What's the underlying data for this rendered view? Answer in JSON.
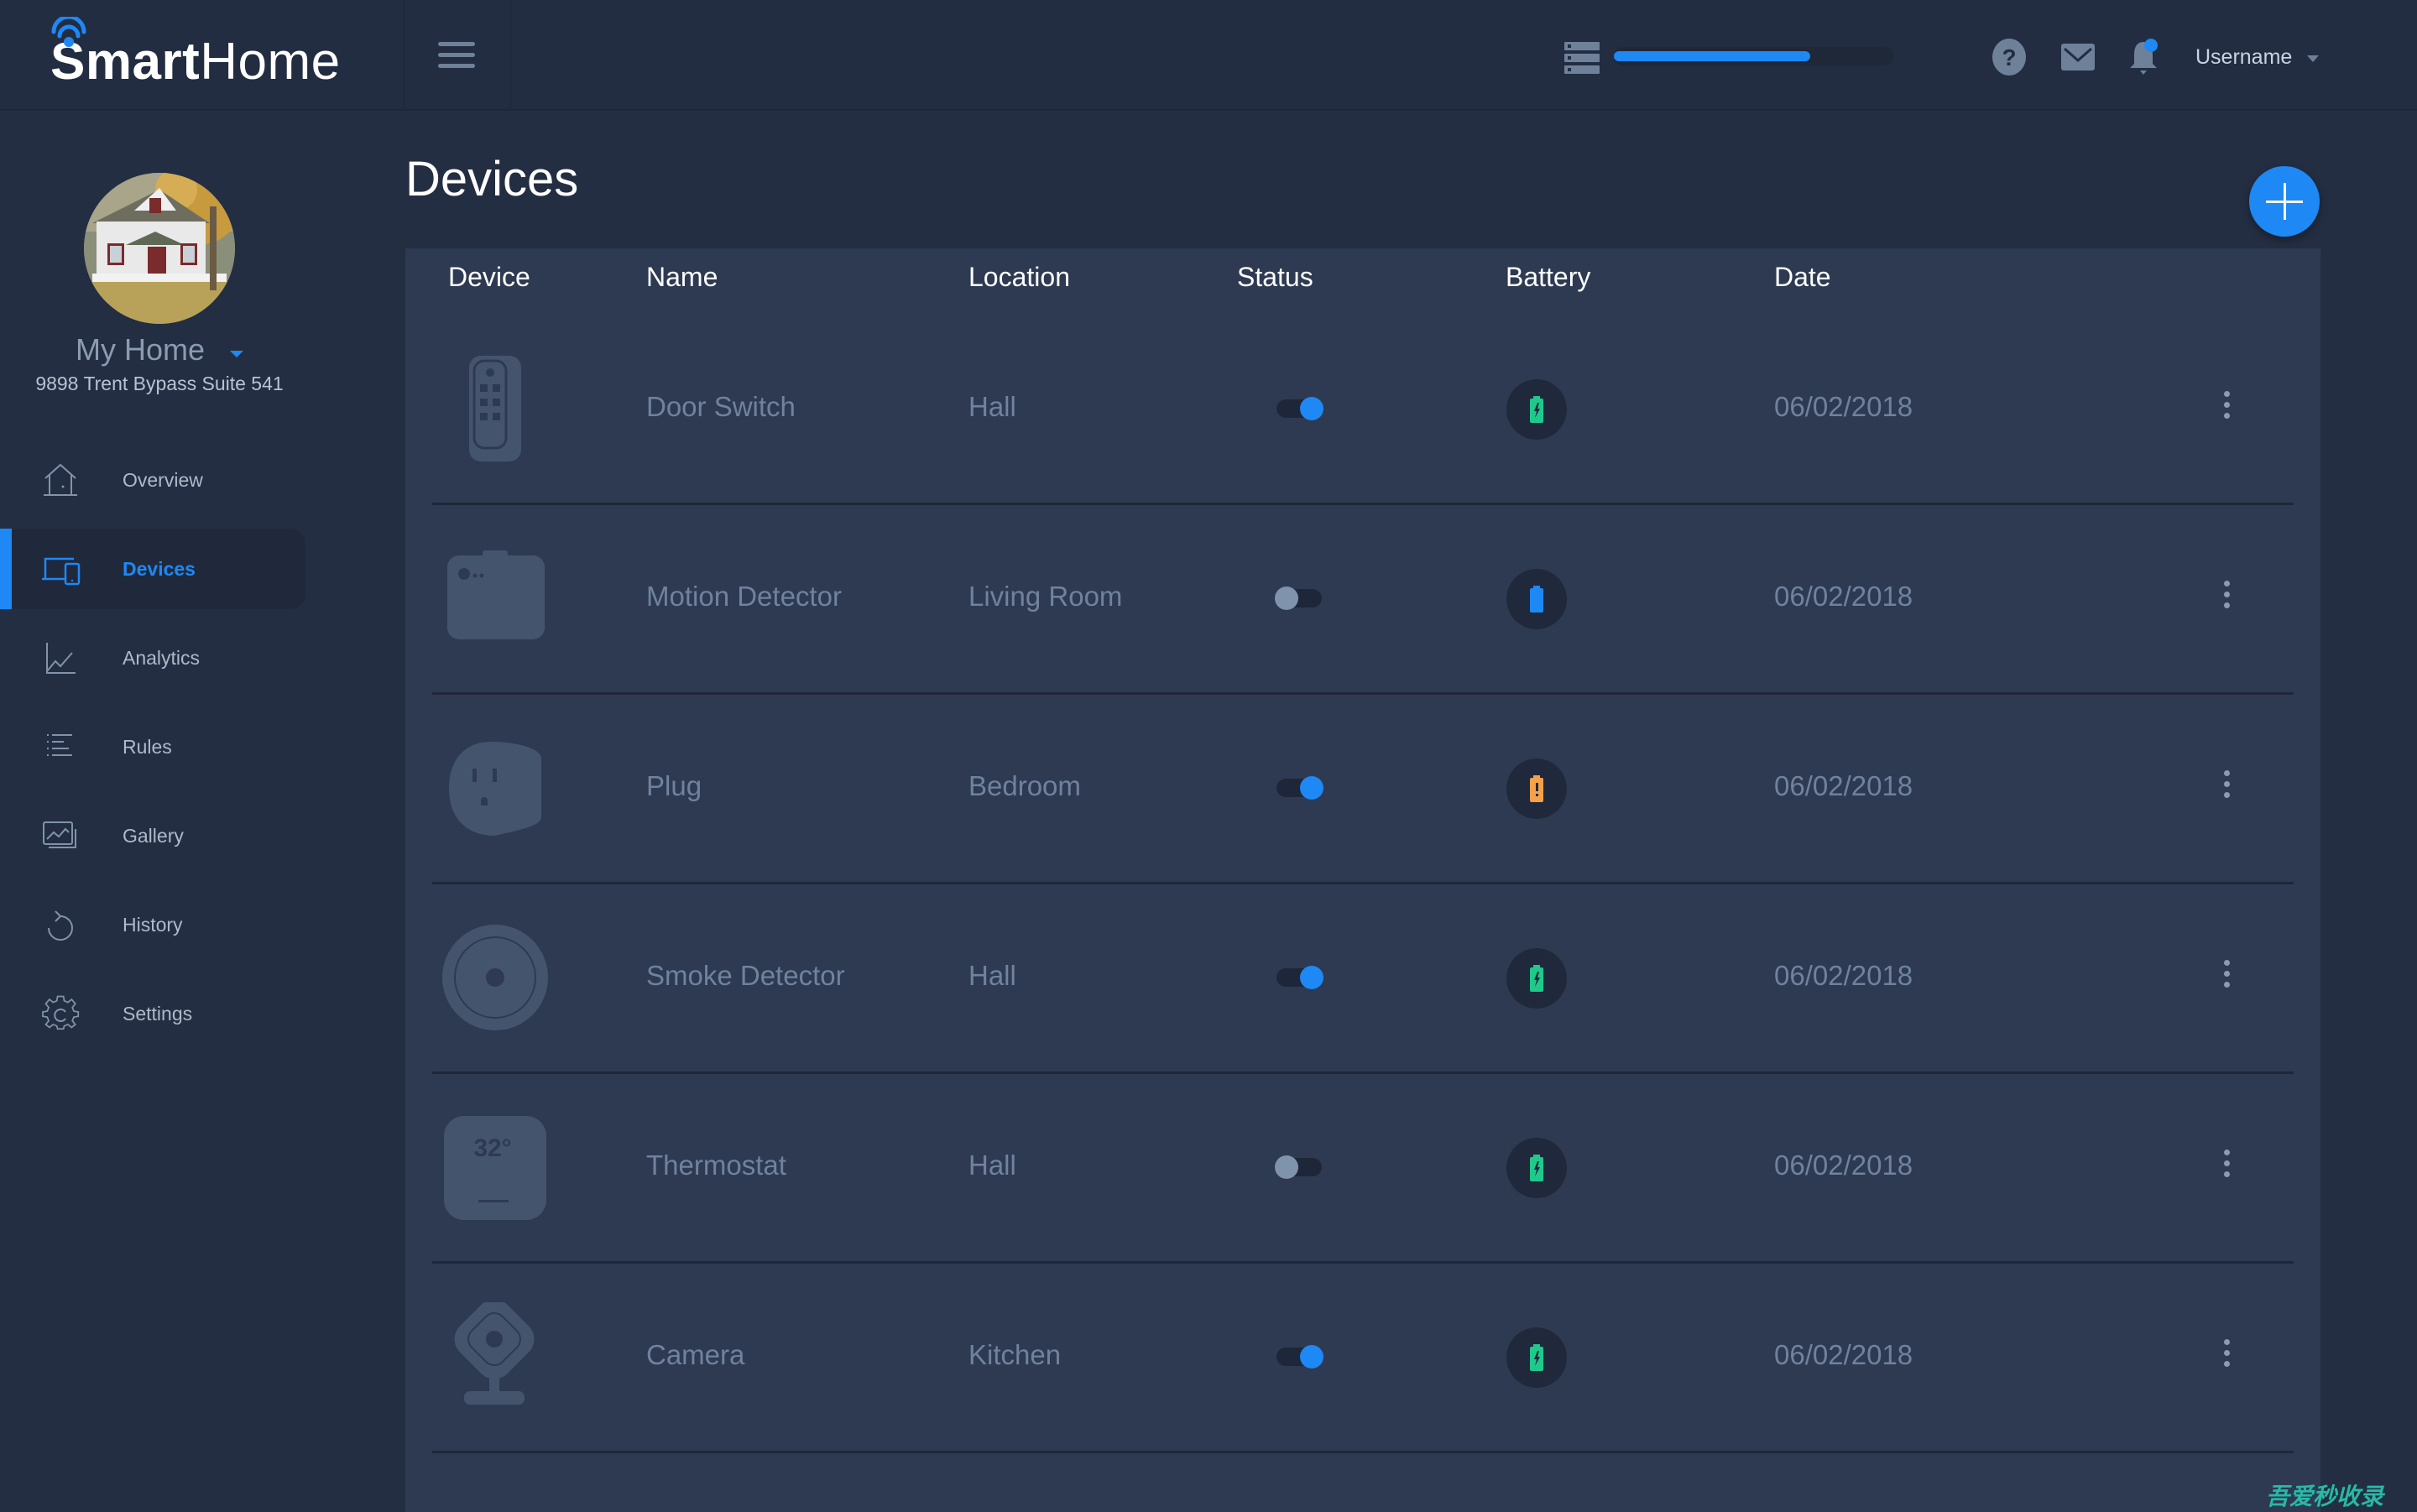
{
  "app": {
    "logo_bold": "Smart",
    "logo_light": "Home"
  },
  "topbar": {
    "storage_progress_percent": 70,
    "icons": [
      "storage-icon",
      "help-icon",
      "mail-icon",
      "bell-icon"
    ],
    "username": "Username",
    "notification_badge": true
  },
  "sidebar": {
    "home_name": "My Home",
    "address": "9898 Trent Bypass Suite 541",
    "items": [
      {
        "label": "Overview",
        "icon": "home-icon",
        "active": false
      },
      {
        "label": "Devices",
        "icon": "devices-icon",
        "active": true
      },
      {
        "label": "Analytics",
        "icon": "analytics-icon",
        "active": false
      },
      {
        "label": "Rules",
        "icon": "rules-icon",
        "active": false
      },
      {
        "label": "Gallery",
        "icon": "gallery-icon",
        "active": false
      },
      {
        "label": "History",
        "icon": "history-icon",
        "active": false
      },
      {
        "label": "Settings",
        "icon": "gear-icon",
        "active": false
      }
    ]
  },
  "main": {
    "title": "Devices",
    "add_button_icon": "plus-icon",
    "columns": [
      "Device",
      "Name",
      "Location",
      "Status",
      "Battery",
      "Date"
    ],
    "rows": [
      {
        "device_icon": "door-switch-icon",
        "name": "Door Switch",
        "location": "Hall",
        "status": "on",
        "battery": "charging",
        "date": "06/02/2018"
      },
      {
        "device_icon": "motion-detector-icon",
        "name": "Motion Detector",
        "location": "Living Room",
        "status": "off",
        "battery": "full",
        "date": "06/02/2018"
      },
      {
        "device_icon": "plug-icon",
        "name": "Plug",
        "location": "Bedroom",
        "status": "on",
        "battery": "low",
        "date": "06/02/2018"
      },
      {
        "device_icon": "smoke-detector-icon",
        "name": "Smoke Detector",
        "location": "Hall",
        "status": "on",
        "battery": "charging",
        "date": "06/02/2018"
      },
      {
        "device_icon": "thermostat-icon",
        "name": "Thermostat",
        "location": "Hall",
        "status": "off",
        "battery": "charging",
        "date": "06/02/2018",
        "display_value": "32°"
      },
      {
        "device_icon": "camera-icon",
        "name": "Camera",
        "location": "Kitchen",
        "status": "on",
        "battery": "charging",
        "date": "06/02/2018"
      }
    ]
  },
  "colors": {
    "accent": "#1e88f5",
    "battery_charging": "#1fc98b",
    "battery_full": "#1e88f5",
    "battery_low": "#f5a04a"
  },
  "watermark": "吾爱秒收录"
}
